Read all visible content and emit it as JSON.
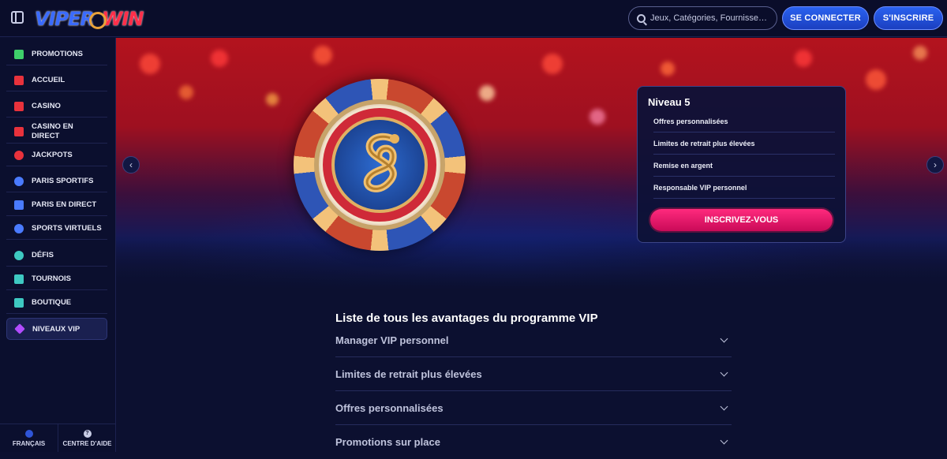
{
  "header": {
    "logo_text_a": "VIPER",
    "logo_text_b": "WIN",
    "search_placeholder": "Jeux, Catégories, Fournisseu...",
    "login_label": "SE CONNECTER",
    "signup_label": "S'INSCRIRE"
  },
  "sidebar": {
    "items": [
      {
        "label": "PROMOTIONS",
        "icon": "gift-icon",
        "color": "#3ecf6a"
      },
      {
        "label": "ACCUEIL",
        "icon": "home-icon",
        "color": "#e8323c"
      },
      {
        "label": "CASINO",
        "icon": "slot-machine-icon",
        "color": "#e8323c"
      },
      {
        "label": "CASINO EN DIRECT",
        "icon": "live-casino-icon",
        "color": "#e8323c"
      },
      {
        "label": "JACKPOTS",
        "icon": "jackpot-icon",
        "color": "#e8323c"
      },
      {
        "label": "PARIS SPORTIFS",
        "icon": "ball-icon",
        "color": "#4a7bff"
      },
      {
        "label": "PARIS EN DIRECT",
        "icon": "live-bet-icon",
        "color": "#4a7bff"
      },
      {
        "label": "SPORTS VIRTUELS",
        "icon": "gamepad-icon",
        "color": "#4a7bff"
      },
      {
        "label": "DÉFIS",
        "icon": "medal-icon",
        "color": "#3ec9c2"
      },
      {
        "label": "TOURNOIS",
        "icon": "trophy-icon",
        "color": "#3ec9c2"
      },
      {
        "label": "BOUTIQUE",
        "icon": "shop-icon",
        "color": "#3ec9c2"
      },
      {
        "label": "NIVEAUX VIP",
        "icon": "diamond-icon",
        "color": "#b24cff"
      }
    ],
    "footer": {
      "language_label": "FRANÇAIS",
      "help_label": "CENTRE D'AIDE"
    }
  },
  "hero": {
    "prev_icon": "chevron-left-icon",
    "next_icon": "chevron-right-icon",
    "card": {
      "title": "Niveau 5",
      "perks": [
        "Offres personnalisées",
        "Limites de retrait plus élevées",
        "Remise en argent",
        "Responsable VIP personnel"
      ],
      "cta_label": "INSCRIVEZ-VOUS"
    }
  },
  "benefits": {
    "title": "Liste de tous les avantages du programme VIP",
    "items": [
      "Manager VIP personnel",
      "Limites de retrait plus élevées",
      "Offres personnalisées",
      "Promotions sur place"
    ]
  }
}
